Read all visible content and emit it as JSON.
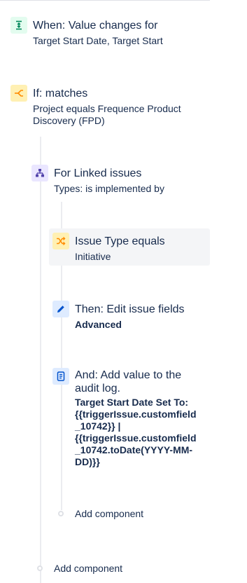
{
  "trigger": {
    "icon": "value-change-icon",
    "title": "When: Value changes for",
    "subtitle": "Target Start Date, Target Start"
  },
  "if_condition": {
    "icon": "branch-condition-icon",
    "title": "If: matches",
    "subtitle": "Project equals Frequence Product Discovery (FPD)"
  },
  "branch": {
    "icon": "hierarchy-icon",
    "title": "For Linked issues",
    "subtitle": "Types: is implemented by"
  },
  "issue_condition": {
    "icon": "shuffle-icon",
    "title": "Issue Type equals",
    "subtitle": "Initiative"
  },
  "edit_action": {
    "icon": "pencil-icon",
    "title": "Then: Edit issue fields",
    "detail": "Advanced"
  },
  "audit_action": {
    "icon": "document-icon",
    "title_line1": "And: Add value to the",
    "title_line2": "audit log.",
    "detail_lines": [
      "Target Start Date Set To:",
      "{{triggerIssue.customfield",
      "_10742}} |",
      "{{triggerIssue.customfield",
      "_10742.toDate(YYYY-MM-",
      "DD)}}"
    ]
  },
  "add_component_inner": "Add component",
  "add_component_outer": "Add component",
  "colors": {
    "text": "#172b4d",
    "green_bg": "#e3fcef",
    "green_fg": "#00875a",
    "yellow_bg": "#fff0b3",
    "yellow_fg": "#ff8b00",
    "purple_bg": "#eae6ff",
    "purple_fg": "#5243aa",
    "blue_bg": "#deebff",
    "blue_fg": "#0052cc",
    "line": "#ebecf0"
  }
}
